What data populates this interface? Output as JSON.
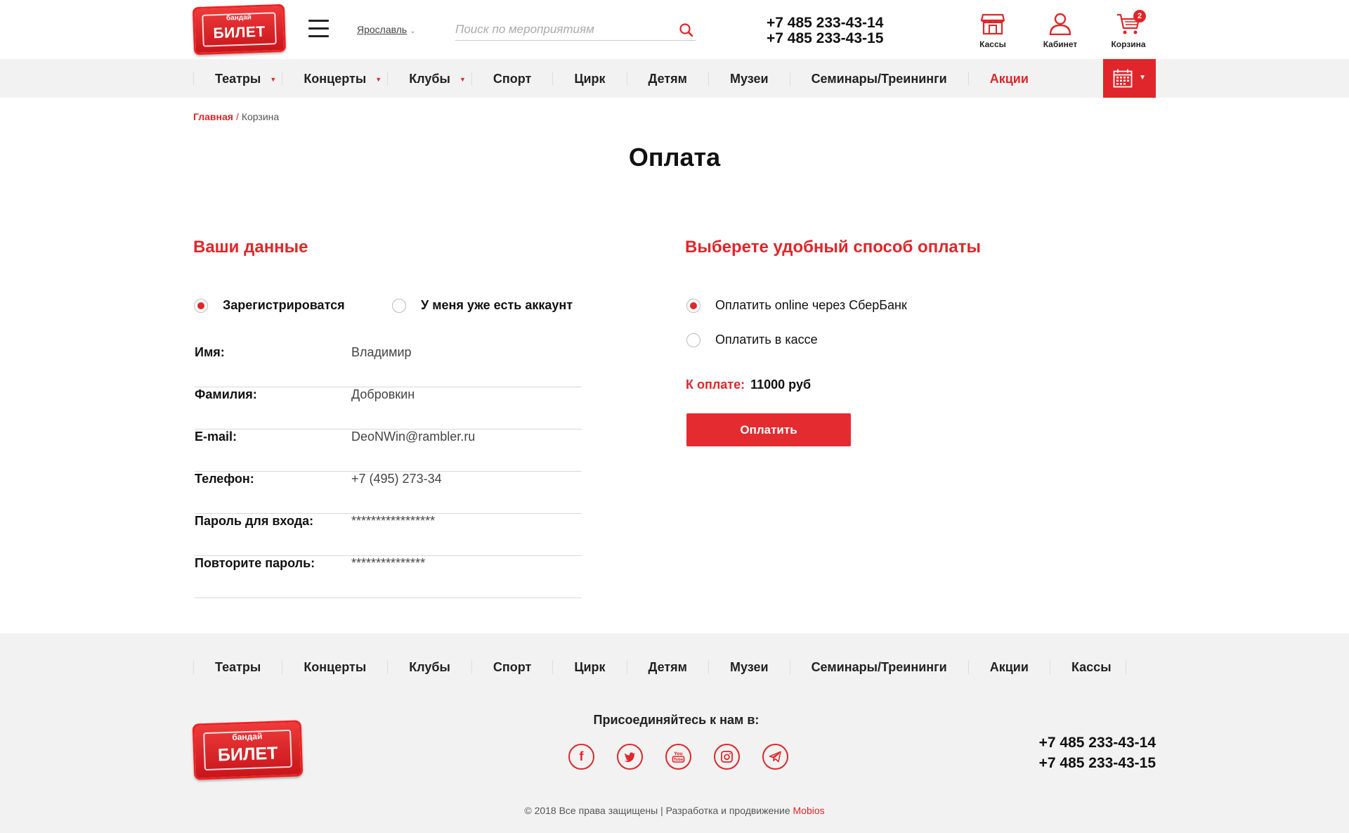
{
  "header": {
    "logo_small": "бандай",
    "logo_big": "БИЛЕТ",
    "city": "Ярославль",
    "search_placeholder": "Поиск по мероприятиям",
    "phone1": "+7 485 233-43-14",
    "phone2": "+7 485 233-43-15",
    "icons": {
      "kassy": "Кассы",
      "cabinet": "Кабинет",
      "cart": "Корзина",
      "cart_count": "2"
    }
  },
  "nav": {
    "items": [
      {
        "label": "Театры"
      },
      {
        "label": "Концерты"
      },
      {
        "label": "Клубы"
      },
      {
        "label": "Спорт"
      },
      {
        "label": "Цирк"
      },
      {
        "label": "Детям"
      },
      {
        "label": "Музеи"
      },
      {
        "label": "Семинары/Треининги"
      },
      {
        "label": "Акции"
      }
    ]
  },
  "breadcrumb": {
    "home": "Главная",
    "sep": "/",
    "current": "Корзина"
  },
  "page_title": "Оплата",
  "left": {
    "heading": "Ваши данные",
    "radio_register": "Зарегистрироватся",
    "radio_have_account": "У меня уже есть аккаунт",
    "fields": [
      {
        "label": "Имя:",
        "value": "Владимир"
      },
      {
        "label": "Фамилия:",
        "value": "Добровкин"
      },
      {
        "label": "E-mail:",
        "value": "DeoNWin@rambler.ru"
      },
      {
        "label": "Телефон:",
        "value": "+7 (495) 273-34"
      },
      {
        "label": "Пароль для входа:",
        "value": "*****************"
      },
      {
        "label": "Повторите пароль:",
        "value": "***************"
      }
    ]
  },
  "right": {
    "heading": "Выберете удобный способ оплаты",
    "option_online": "Оплатить online через СберБанк",
    "option_kassa": "Оплатить в кассе",
    "total_label": "К оплате:",
    "total_value": "11000 руб",
    "pay_button": "Оплатить"
  },
  "footer": {
    "nav": [
      "Театры",
      "Концерты",
      "Клубы",
      "Спорт",
      "Цирк",
      "Детям",
      "Музеи",
      "Семинары/Треининги",
      "Акции",
      "Кассы"
    ],
    "join": "Присоединяйтесь к нам в:",
    "phone1": "+7 485 233-43-14",
    "phone2": "+7 485 233-43-15",
    "copyright": "© 2018 Все права защищены | Разработка и продвижение",
    "dev_link": "Mobios",
    "logo_small": "бандай",
    "logo_big": "БИЛЕТ"
  },
  "colors": {
    "accent": "#e0262a",
    "nav_bg": "#f2f2f2"
  }
}
